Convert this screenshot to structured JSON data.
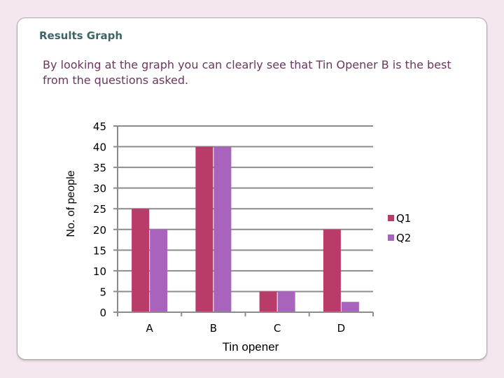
{
  "slide": {
    "title": "Results Graph",
    "description": "By looking at the graph you can clearly see that Tin Opener B is the best from the questions asked."
  },
  "chart_data": {
    "type": "bar",
    "title": "",
    "xlabel": "Tin opener",
    "ylabel": "No. of people",
    "categories": [
      "A",
      "B",
      "C",
      "D"
    ],
    "series": [
      {
        "name": "Q1",
        "color": "#b83b6a",
        "values": [
          25,
          40,
          5,
          20
        ]
      },
      {
        "name": "Q2",
        "color": "#a864bd",
        "values": [
          20,
          40,
          5,
          2.5
        ]
      }
    ],
    "ylim": [
      0,
      45
    ],
    "yticks": [
      0,
      5,
      10,
      15,
      20,
      25,
      30,
      35,
      40,
      45
    ],
    "grid": true,
    "legend": "right"
  }
}
